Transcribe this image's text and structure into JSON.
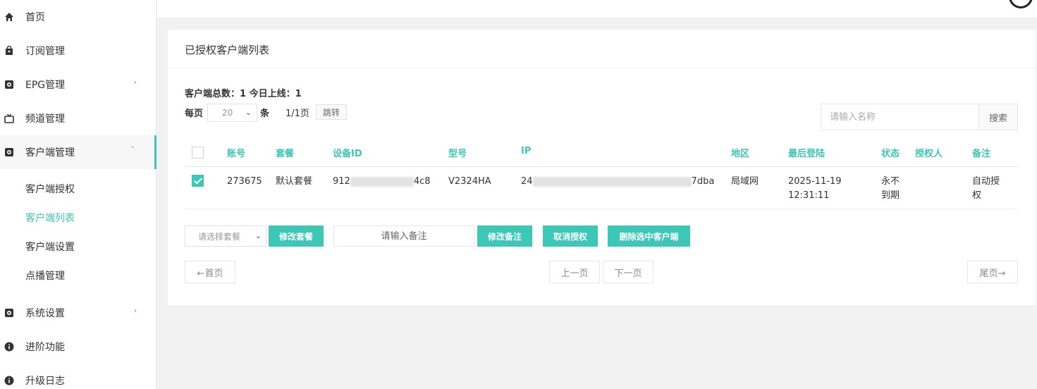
{
  "sidebar": {
    "items": [
      {
        "label": "首页",
        "icon": "home-icon"
      },
      {
        "label": "订阅管理",
        "icon": "bag-icon"
      },
      {
        "label": "EPG管理",
        "icon": "gear-icon"
      },
      {
        "label": "频道管理",
        "icon": "tv-icon"
      },
      {
        "label": "客户端管理",
        "icon": "gear-icon"
      },
      {
        "label": "系统设置",
        "icon": "gear-icon"
      },
      {
        "label": "进阶功能",
        "icon": "info-icon"
      },
      {
        "label": "升级日志",
        "icon": "info-icon"
      }
    ],
    "subitems": [
      {
        "label": "客户端授权"
      },
      {
        "label": "客户端列表"
      },
      {
        "label": "客户端设置"
      },
      {
        "label": "点播管理"
      }
    ],
    "chevron_right": "›",
    "chevron_down": "ˇ"
  },
  "card": {
    "title": "已授权客户端列表",
    "stats": "客户端总数：1 今日上线：1",
    "per_page_label": "每页",
    "per_page_value": "20",
    "per_page_unit": "条",
    "page_info": "1/1页",
    "jump_label": "跳转",
    "search_placeholder": "请输入名称",
    "search_label": "搜索"
  },
  "table": {
    "headers": [
      "账号",
      "套餐",
      "设备ID",
      "型号",
      "IP",
      "地区",
      "最后登陆",
      "状态",
      "授权人",
      "备注"
    ],
    "rows": [
      {
        "account": "273675",
        "package": "默认套餐",
        "device_id_prefix": "912",
        "device_id_suffix": "4c8",
        "model": "V2324HA",
        "ip_prefix": "24",
        "ip_suffix": "7dba",
        "region": "局域网",
        "last_login_date": "2025-11-19",
        "last_login_time": "12:31:11",
        "status_line1": "永不",
        "status_line2": "到期",
        "authorizer": "",
        "remark_line1": "自动授",
        "remark_line2": "权",
        "checked": true
      }
    ]
  },
  "actions": {
    "package_placeholder": "请选择套餐",
    "modify_package": "修改套餐",
    "remark_placeholder": "请输入备注",
    "modify_remark": "修改备注",
    "cancel_auth": "取消授权",
    "delete_selected": "删除选中客户端"
  },
  "pager": {
    "first": "←首页",
    "prev": "上一页",
    "next": "下一页",
    "last": "尾页→"
  },
  "colors": {
    "accent": "#3cc7b6"
  }
}
